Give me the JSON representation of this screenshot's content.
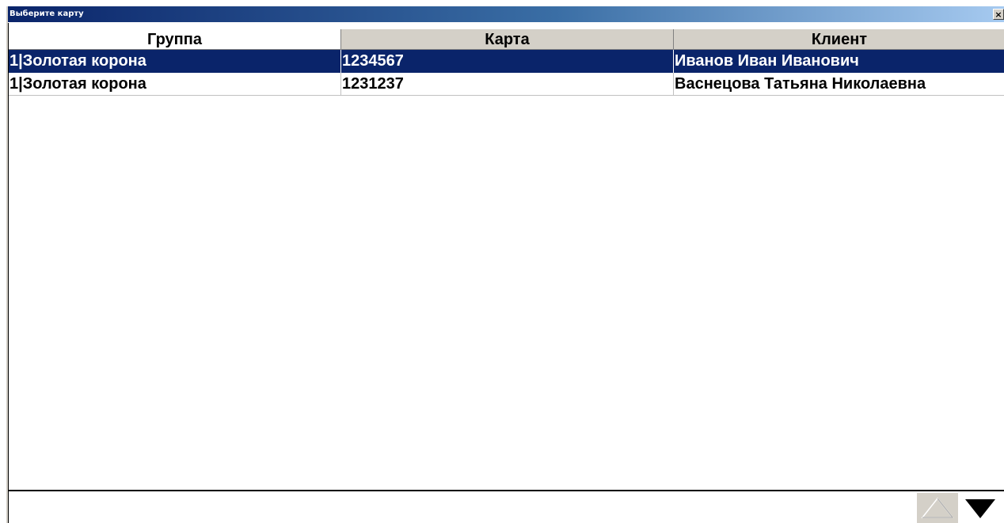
{
  "window": {
    "title": "Выберите карту",
    "close_label": "×"
  },
  "table": {
    "columns": [
      "Группа",
      "Карта",
      "Клиент"
    ],
    "rows": [
      {
        "group": "1|Золотая корона",
        "card": "1234567",
        "client": "Иванов Иван Иванович",
        "selected": true
      },
      {
        "group": "1|Золотая корона",
        "card": "1231237",
        "client": "Васнецова Татьяна Николаевна",
        "selected": false
      }
    ]
  },
  "search": {
    "value": ""
  },
  "scroll": {
    "up_icon": "triangle-up-outline-icon",
    "down_icon": "triangle-down-filled-icon"
  },
  "colors": {
    "selection": "#0a246a",
    "header_bg": "#d4d0c8"
  }
}
